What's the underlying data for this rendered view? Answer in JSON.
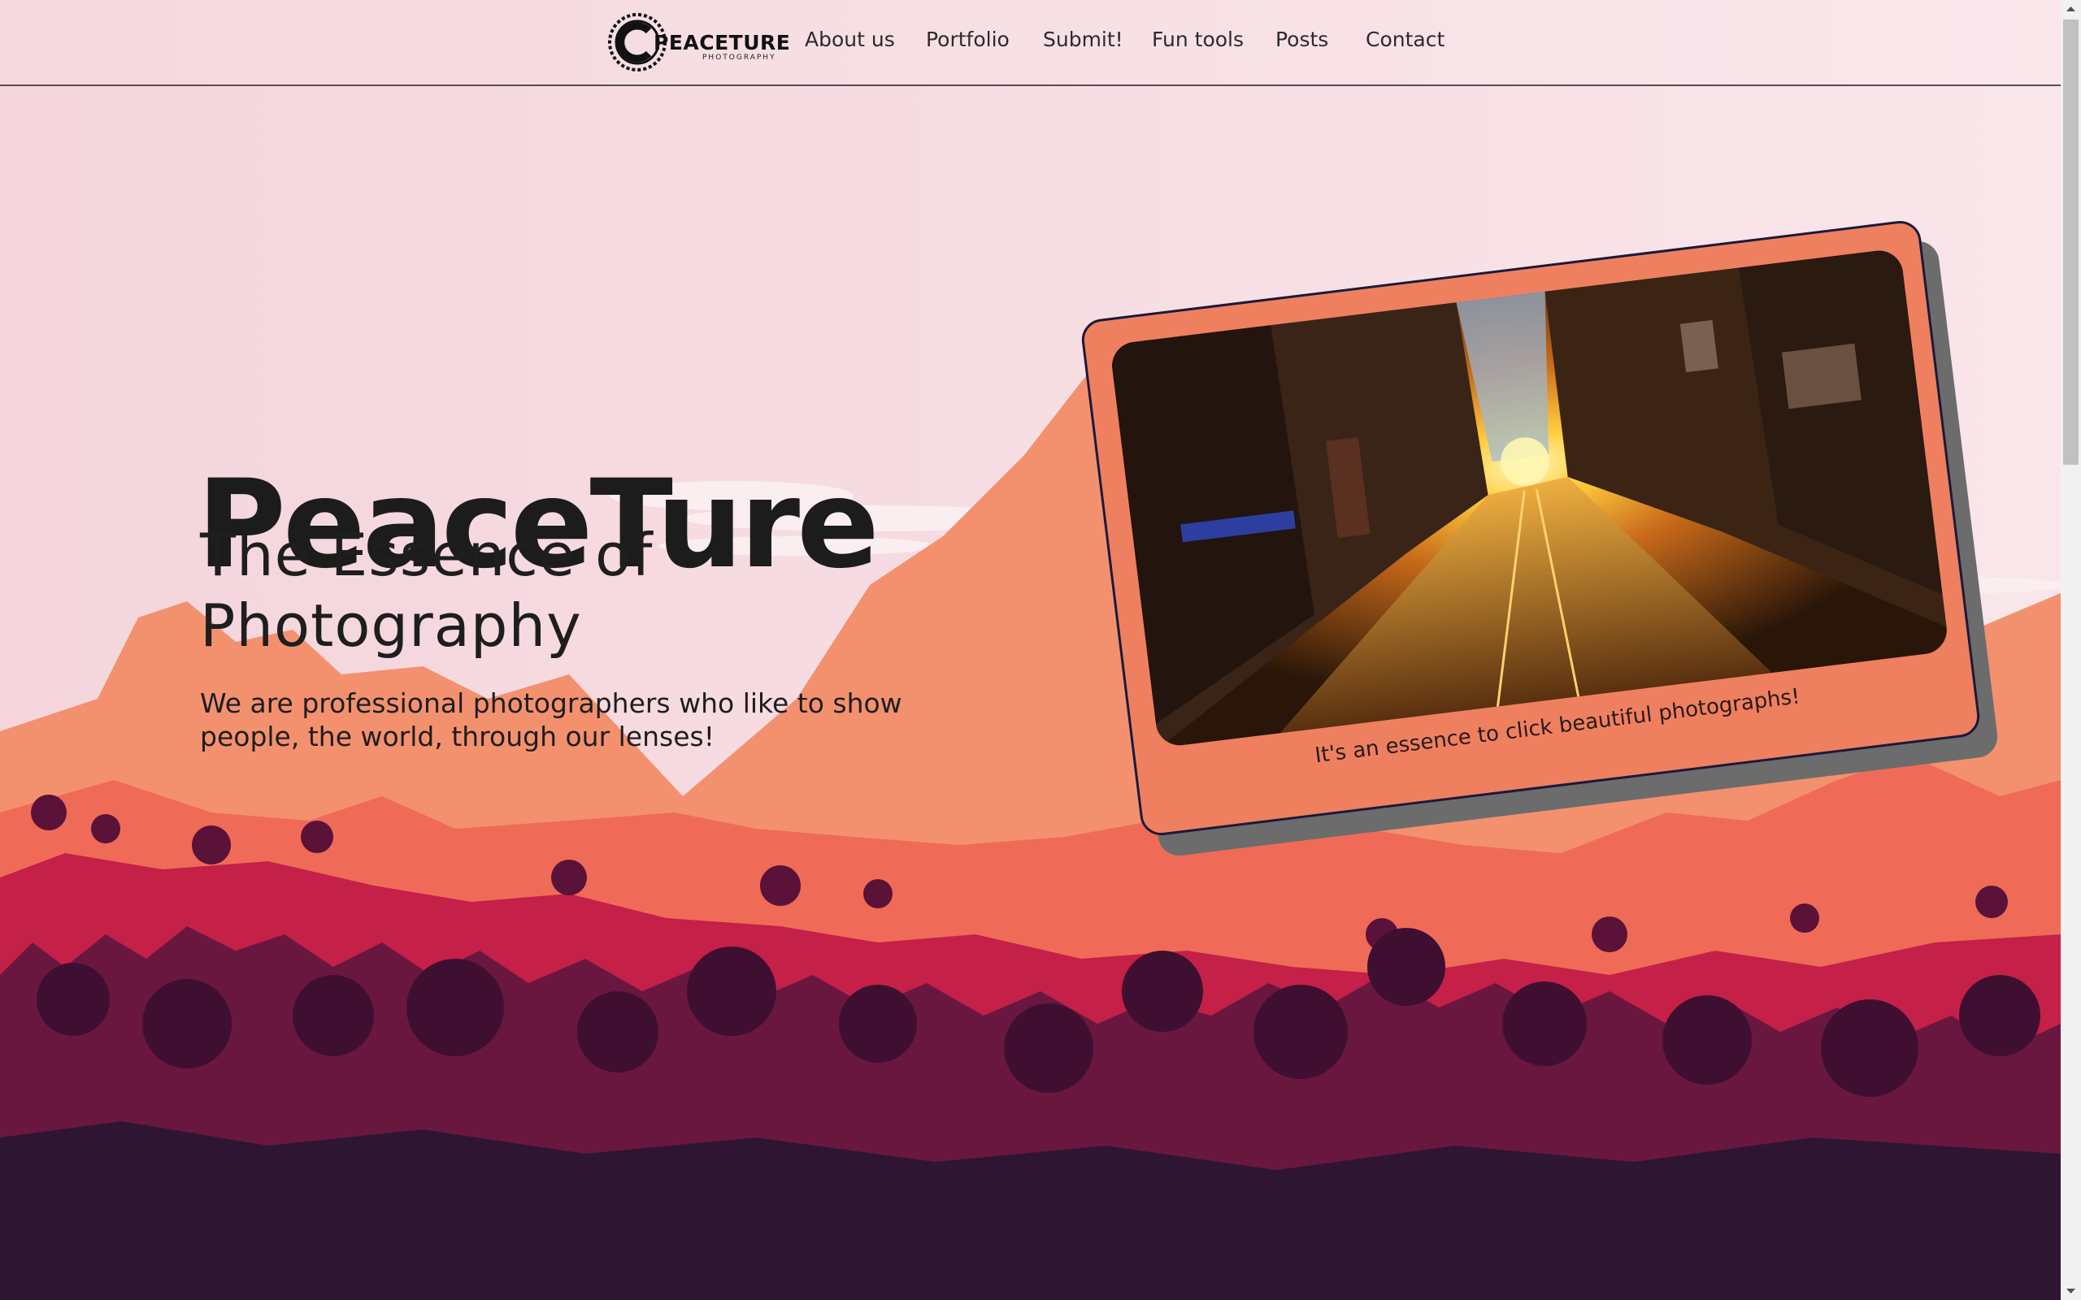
{
  "nav": {
    "logo_text": "PEACETURE",
    "logo_sub": "PHOTOGRAPHY",
    "links": [
      "About us",
      "Portfolio",
      "Submit!",
      "Fun tools",
      "Posts",
      "Contact"
    ]
  },
  "hero": {
    "title": "PeaceTure",
    "subtitle": "The Essence of Photography",
    "description": "We are professional photographers who like to show people, the world, through our lenses!"
  },
  "card": {
    "caption": "It's an essence to click beautiful photographs!"
  },
  "colors": {
    "sky": "#f5dde2",
    "mountain_light": "#f3916e",
    "mountain_mid": "#ef6b57",
    "hills_red": "#c42048",
    "forest_dark": "#6a1740",
    "ground": "#2e1632",
    "card_bg": "#ee8060",
    "card_shadow": "#6c6c6c"
  }
}
